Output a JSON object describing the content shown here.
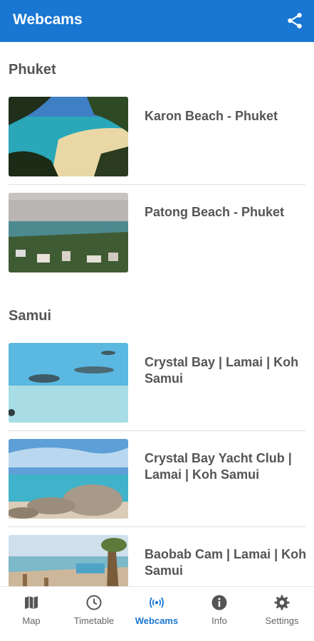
{
  "app": {
    "title": "Webcams",
    "share_icon": "share-icon",
    "accent": "#1976d2"
  },
  "sections": [
    {
      "title": "Phuket",
      "items": [
        {
          "label": "Karon Beach - Phuket"
        },
        {
          "label": "Patong Beach - Phuket"
        }
      ]
    },
    {
      "title": "Samui",
      "items": [
        {
          "label": "Crystal Bay | Lamai | Koh Samui"
        },
        {
          "label": "Crystal Bay Yacht Club | Lamai | Koh Samui"
        },
        {
          "label": "Baobab Cam | Lamai | Koh Samui"
        }
      ]
    }
  ],
  "bottom_nav": [
    {
      "label": "Map",
      "icon": "map-icon"
    },
    {
      "label": "Timetable",
      "icon": "clock-icon"
    },
    {
      "label": "Webcams",
      "icon": "webcam-signal-icon",
      "active": true
    },
    {
      "label": "Info",
      "icon": "info-icon"
    },
    {
      "label": "Settings",
      "icon": "gear-icon"
    }
  ]
}
